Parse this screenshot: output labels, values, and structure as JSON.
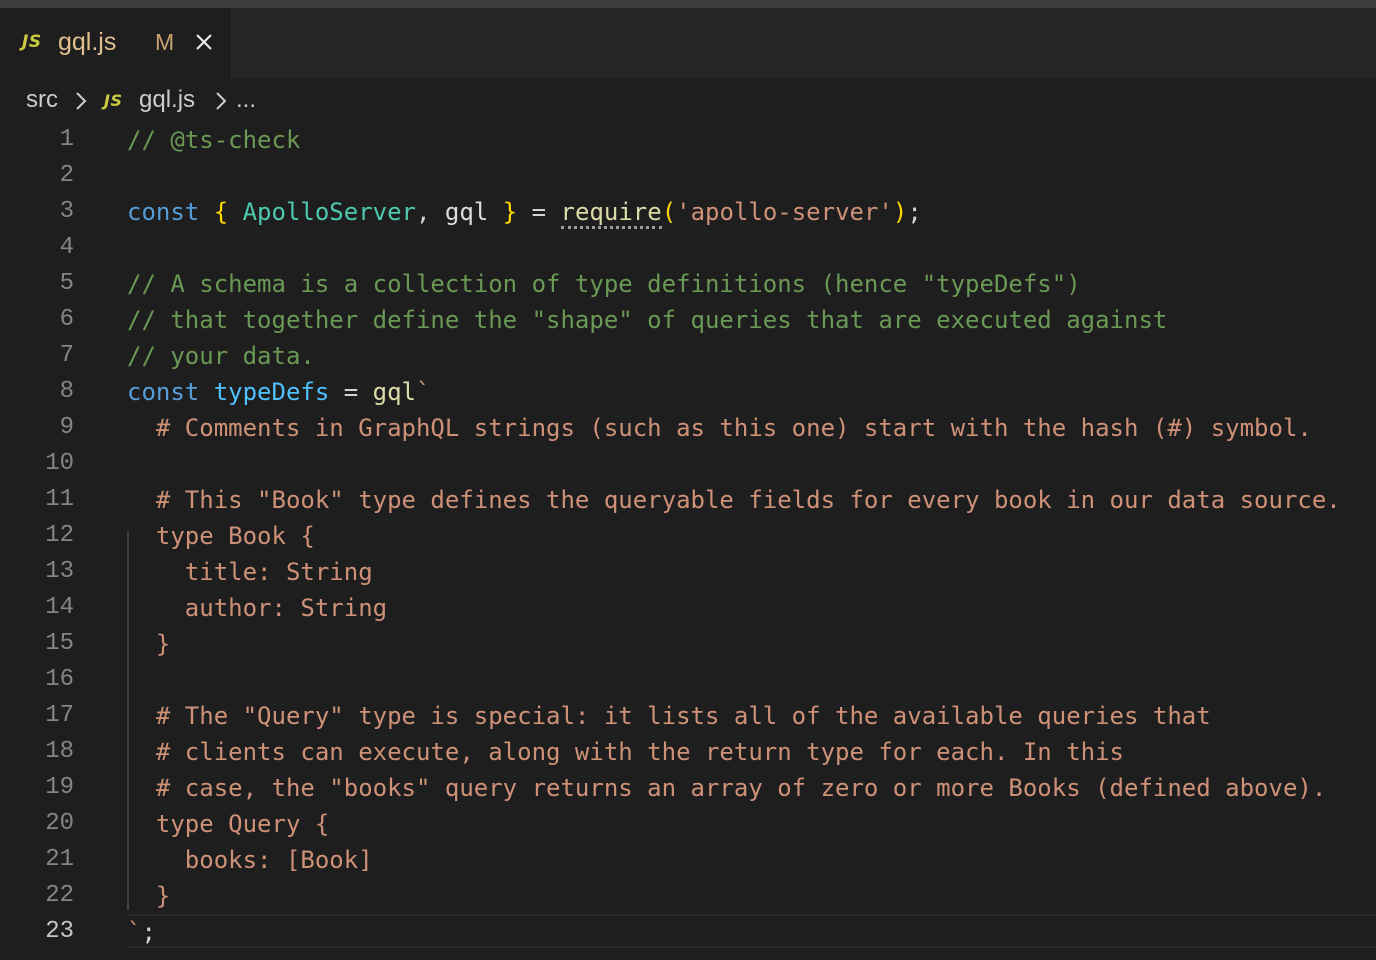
{
  "tab": {
    "icon": "JS",
    "icon_name": "javascript-file-icon",
    "filename": "gql.js",
    "status": "M",
    "close_icon": "close-icon"
  },
  "breadcrumb": {
    "folder": "src",
    "icon": "JS",
    "file": "gql.js",
    "more": "..."
  },
  "editor": {
    "current_line": 23,
    "lines": [
      {
        "n": "1"
      },
      {
        "n": "2"
      },
      {
        "n": "3"
      },
      {
        "n": "4"
      },
      {
        "n": "5"
      },
      {
        "n": "6"
      },
      {
        "n": "7"
      },
      {
        "n": "8"
      },
      {
        "n": "9"
      },
      {
        "n": "10"
      },
      {
        "n": "11"
      },
      {
        "n": "12"
      },
      {
        "n": "13"
      },
      {
        "n": "14"
      },
      {
        "n": "15"
      },
      {
        "n": "16"
      },
      {
        "n": "17"
      },
      {
        "n": "18"
      },
      {
        "n": "19"
      },
      {
        "n": "20"
      },
      {
        "n": "21"
      },
      {
        "n": "22"
      },
      {
        "n": "23"
      }
    ],
    "code": {
      "l1": "// @ts-check",
      "l3_const": "const",
      "l3_open": "{",
      "l3_apollo": "ApolloServer",
      "l3_comma": ",",
      "l3_gql": "gql",
      "l3_close": "}",
      "l3_eq": "=",
      "l3_require": "require",
      "l3_popen": "(",
      "l3_str": "'apollo-server'",
      "l3_pclose": ")",
      "l3_semi": ";",
      "l5": "// A schema is a collection of type definitions (hence \"typeDefs\")",
      "l6": "// that together define the \"shape\" of queries that are executed against",
      "l7": "// your data.",
      "l8_const": "const",
      "l8_var": "typeDefs",
      "l8_eq": "=",
      "l8_gql": "gql",
      "l8_tick": "`",
      "l9": "  # Comments in GraphQL strings (such as this one) start with the hash (#) symbol.",
      "l11": "  # This \"Book\" type defines the queryable fields for every book in our data source.",
      "l12": "  type Book {",
      "l13": "    title: String",
      "l14": "    author: String",
      "l15": "  }",
      "l17": "  # The \"Query\" type is special: it lists all of the available queries that",
      "l18": "  # clients can execute, along with the return type for each. In this",
      "l19": "  # case, the \"books\" query returns an array of zero or more Books (defined above).",
      "l20": "  type Query {",
      "l21": "    books: [Book]",
      "l22": "  }",
      "l23_tick": "`",
      "l23_semi": ";"
    }
  },
  "colors": {
    "background": "#1e1e1e",
    "comment": "#6a9955",
    "keyword": "#569cd6",
    "string": "#ce9178",
    "class": "#4ec9b0",
    "function": "#dcdcaa",
    "bracket": "#ffd700",
    "modified": "#e2c08d"
  }
}
